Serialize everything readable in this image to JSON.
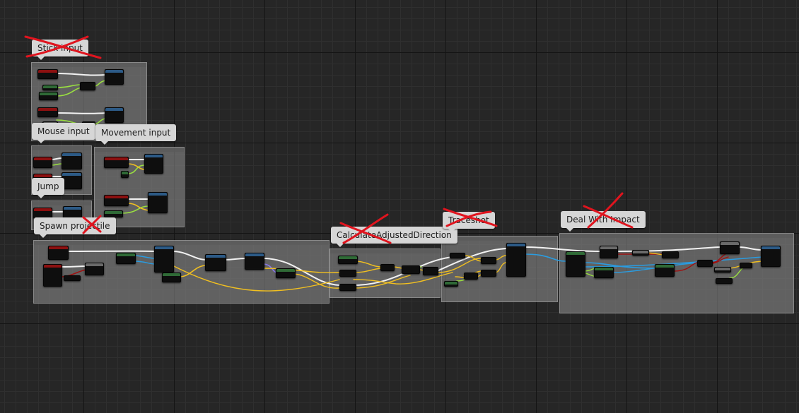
{
  "colors": {
    "graph_background": "#262626",
    "comment_fill": "#8c8c8c",
    "comment_label_bg": "#d6d6d6",
    "strike_mark": "#e0141e",
    "wire_exec": "#f2f2f2",
    "wire_float": "#9ae040",
    "wire_vector": "#f2c020",
    "wire_object": "#2a9ce0",
    "wire_bool": "#a01010",
    "wire_struct": "#8878e8",
    "node_header_red": "#8c1010",
    "node_header_blue": "#2c5a86",
    "node_header_green": "#2f6a36",
    "node_header_gray": "#6a6a6a"
  },
  "comments": [
    {
      "id": "stick_input",
      "label": "Stick input",
      "crossed_out": true
    },
    {
      "id": "mouse_input",
      "label": "Mouse input",
      "crossed_out": false
    },
    {
      "id": "movement_input",
      "label": "Movement input",
      "crossed_out": false
    },
    {
      "id": "jump",
      "label": "Jump",
      "crossed_out": false
    },
    {
      "id": "spawn_projectile",
      "label": "Spawn projectile",
      "crossed_out": true
    },
    {
      "id": "calculate_adjusted_direction",
      "label": "CalculateAdjustedDirection",
      "crossed_out": true
    },
    {
      "id": "traceshot",
      "label": "Traceshot",
      "crossed_out": true
    },
    {
      "id": "deal_with_impact",
      "label": "Deal With Impact",
      "crossed_out": true
    }
  ]
}
